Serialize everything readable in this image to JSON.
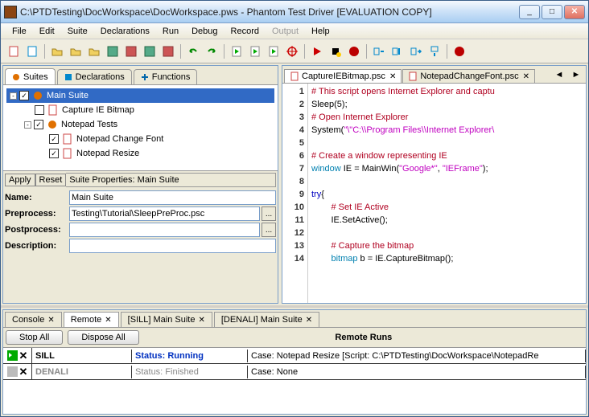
{
  "title": "C:\\PTDTesting\\DocWorkspace\\DocWorkspace.pws - Phantom Test Driver [EVALUATION COPY]",
  "menus": [
    "File",
    "Edit",
    "Suite",
    "Declarations",
    "Run",
    "Debug",
    "Record",
    "Output",
    "Help"
  ],
  "menu_disabled": [
    "Output"
  ],
  "leftTabs": {
    "suites": "Suites",
    "decls": "Declarations",
    "funcs": "Functions"
  },
  "tree": [
    {
      "indent": 0,
      "exp": "-",
      "chk": true,
      "icon": "suite",
      "label": "Main Suite",
      "sel": true
    },
    {
      "indent": 1,
      "exp": "",
      "chk": false,
      "icon": "script",
      "label": "Capture IE Bitmap"
    },
    {
      "indent": 1,
      "exp": "-",
      "chk": true,
      "icon": "suite",
      "label": "Notepad Tests"
    },
    {
      "indent": 2,
      "exp": "",
      "chk": true,
      "icon": "script",
      "label": "Notepad Change Font"
    },
    {
      "indent": 2,
      "exp": "",
      "chk": true,
      "icon": "script",
      "label": "Notepad Resize"
    }
  ],
  "propBar": {
    "apply": "Apply",
    "reset": "Reset",
    "title": "Suite Properties: Main Suite"
  },
  "props": {
    "name_l": "Name:",
    "name_v": "Main Suite",
    "pre_l": "Preprocess:",
    "pre_v": "Testing\\Tutorial\\SleepPreProc.psc",
    "post_l": "Postprocess:",
    "post_v": "",
    "desc_l": "Description:",
    "desc_v": ""
  },
  "editorTabs": [
    {
      "label": "CaptureIEBitmap.psc",
      "active": true
    },
    {
      "label": "NotepadChangeFont.psc",
      "active": false
    }
  ],
  "code": [
    {
      "n": 1,
      "h": "<span class='c-com'># This script opens Internet Explorer and captu</span>"
    },
    {
      "n": 2,
      "h": "Sleep(5);"
    },
    {
      "n": 3,
      "h": "<span class='c-com'># Open Internet Explorer</span>"
    },
    {
      "n": 4,
      "h": "System(<span class='c-str'>\"\\\"C:\\\\Program Files\\\\Internet Explorer\\</span>"
    },
    {
      "n": 5,
      "h": ""
    },
    {
      "n": 6,
      "h": "<span class='c-com'># Create a window representing IE</span>"
    },
    {
      "n": 7,
      "h": "<span class='c-type'>window</span> IE = MainWin(<span class='c-str'>\"Google*\"</span>, <span class='c-str'>\"IEFrame\"</span>);"
    },
    {
      "n": 8,
      "h": ""
    },
    {
      "n": 9,
      "h": "<span class='c-key'>try</span>{"
    },
    {
      "n": 10,
      "h": "        <span class='c-com'># Set IE Active</span>"
    },
    {
      "n": 11,
      "h": "        IE.SetActive();"
    },
    {
      "n": 12,
      "h": ""
    },
    {
      "n": 13,
      "h": "        <span class='c-com'># Capture the bitmap</span>"
    },
    {
      "n": 14,
      "h": "        <span class='c-type'>bitmap</span> b = IE.CaptureBitmap();"
    }
  ],
  "bottomTabs": [
    {
      "label": "Console",
      "active": false,
      "x": true
    },
    {
      "label": "Remote",
      "active": true,
      "x": true
    },
    {
      "label": "[SILL] Main Suite",
      "active": false,
      "x": true
    },
    {
      "label": "[DENALI] Main Suite",
      "active": false,
      "x": true
    }
  ],
  "remote": {
    "stopAll": "Stop All",
    "disposeAll": "Dispose All",
    "title": "Remote Runs",
    "rows": [
      {
        "active": true,
        "host": "SILL",
        "status": "Status: Running",
        "case": "Case: Notepad Resize   [Script: C:\\PTDTesting\\DocWorkspace\\NotepadRe"
      },
      {
        "active": false,
        "host": "DENALI",
        "status": "Status: Finished",
        "case": "Case: None"
      }
    ]
  },
  "chart_data": null
}
